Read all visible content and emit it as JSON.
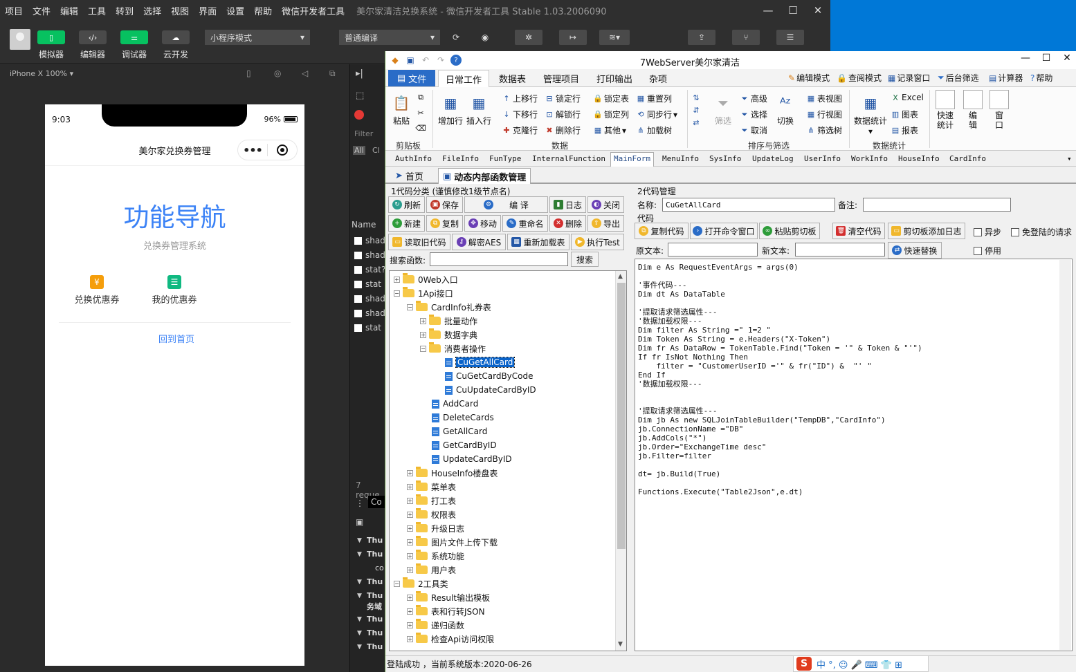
{
  "devtools": {
    "menu": [
      "项目",
      "文件",
      "编辑",
      "工具",
      "转到",
      "选择",
      "视图",
      "界面",
      "设置",
      "帮助",
      "微信开发者工具"
    ],
    "window_title": "美尔家清洁兑换系统 - 微信开发者工具 Stable 1.03.2006090",
    "window_controls": {
      "minimize": "—",
      "maximize": "☐",
      "close": "✕"
    },
    "toolbar": {
      "simulator": "模拟器",
      "editor": "编辑器",
      "debugger": "调试器",
      "cloud": "云开发",
      "mode_select": "小程序模式",
      "compile_select": "普通编译"
    },
    "device_label": "iPhone X 100% ▾",
    "simulator": {
      "time": "9:03",
      "battery": "96%",
      "nav_title": "美尔家兑换券管理",
      "capsule_dots": "•••",
      "heading": "功能导航",
      "subtitle": "兑换券管理系统",
      "function_items": [
        {
          "label": "兑换优惠券",
          "icon": "¥",
          "color": "#f59e0b"
        },
        {
          "label": "我的优惠券",
          "icon": "☰",
          "color": "#10b981"
        }
      ],
      "back_link": "回到首页"
    },
    "panel": {
      "filter_placeholder": "Filter",
      "all": "All",
      "clear": "Cl",
      "name_header": "Name",
      "requests": [
        "shado",
        "shado",
        "stat?",
        "stat",
        "shado",
        "shado",
        "stat"
      ],
      "request_count": "7 reque",
      "console_tab": "Co",
      "log_rows": [
        "Thu",
        "Thu",
        "co",
        "Thu",
        "Thu",
        "务域",
        "Thu",
        "Thu",
        "Thu"
      ]
    }
  },
  "app": {
    "title": "7WebServer美尔家清洁",
    "window_controls": {
      "minimize": "—",
      "maximize": "☐",
      "close": "✕"
    },
    "ribbon_tabs": [
      "文件",
      "日常工作",
      "数据表",
      "管理项目",
      "打印输出",
      "杂项"
    ],
    "ribbon_right": [
      "编辑模式",
      "查阅模式",
      "记录窗口",
      "后台筛选",
      "计算器",
      "帮助"
    ],
    "ribbon": {
      "clipboard": {
        "group": "剪贴板",
        "paste": "粘贴"
      },
      "data": {
        "group": "数据",
        "add_row": "增加行",
        "insert_row": "插入行",
        "move_up": "上移行",
        "move_down": "下移行",
        "clone_row": "克隆行",
        "lock_row": "锁定行",
        "unlock_row": "解锁行",
        "delete_row": "删除行",
        "lock_table": "锁定表",
        "lock_col": "锁定列",
        "other": "其他",
        "reset_col": "重置列",
        "sync_row": "同步行",
        "load_tree": "加载树"
      },
      "sort_filter": {
        "group": "排序与筛选",
        "filter": "筛选",
        "advanced": "高级",
        "select": "选择",
        "cancel": "取消",
        "switch": "切换",
        "table_view": "表视图",
        "row_view": "行视图",
        "filter_tree": "筛选树"
      },
      "stats": {
        "group": "数据统计",
        "data_stats": "数据统计",
        "excel": "Excel",
        "chart": "图表",
        "report": "报表",
        "quick_stats_1": "快速",
        "quick_stats_2": "统计",
        "edit_1": "编",
        "edit_2": "辑",
        "window_1": "窗",
        "window_2": "口"
      }
    },
    "form_tabs": [
      "AuthInfo",
      "FileInfo",
      "FunType",
      "InternalFunction",
      "MainForm",
      "MenuInfo",
      "SysInfo",
      "UpdateLog",
      "UserInfo",
      "WorkInfo",
      "HouseInfo",
      "CardInfo"
    ],
    "doc_tabs": {
      "home": "首页",
      "active": "动态内部函数管理"
    },
    "left": {
      "title": "1代码分类 (谨慎修改1级节点名)",
      "buttons": {
        "refresh": "刷新",
        "save": "保存",
        "compile": "编 译",
        "log": "日志",
        "close": "关闭",
        "new": "新建",
        "copy": "复制",
        "move": "移动",
        "rename": "重命名",
        "delete": "删除",
        "export": "导出",
        "read_old": "读取旧代码",
        "decrypt": "解密AES",
        "reload": "重新加载表",
        "exec": "执行Test"
      },
      "search_label": "搜索函数:",
      "search_value": "",
      "search_button": "搜索"
    },
    "tree": [
      {
        "text": "0Web入口",
        "level": 0,
        "type": "folder",
        "expander": "+"
      },
      {
        "text": "1Api接口",
        "level": 0,
        "type": "folder",
        "expander": "−"
      },
      {
        "text": "CardInfo礼券表",
        "level": 1,
        "type": "folder",
        "expander": "−"
      },
      {
        "text": "批量动作",
        "level": 2,
        "type": "folder",
        "expander": "+"
      },
      {
        "text": "数据字典",
        "level": 2,
        "type": "folder",
        "expander": "+"
      },
      {
        "text": "消费者操作",
        "level": 2,
        "type": "folder",
        "expander": "−"
      },
      {
        "text": "CuGetAllCard",
        "level": 3,
        "type": "doc",
        "selected": true
      },
      {
        "text": "CuGetCardByCode",
        "level": 3,
        "type": "doc"
      },
      {
        "text": "CuUpdateCardByID",
        "level": 3,
        "type": "doc"
      },
      {
        "text": "AddCard",
        "level": 2,
        "type": "doc"
      },
      {
        "text": "DeleteCards",
        "level": 2,
        "type": "doc"
      },
      {
        "text": "GetAllCard",
        "level": 2,
        "type": "doc"
      },
      {
        "text": "GetCardByID",
        "level": 2,
        "type": "doc"
      },
      {
        "text": "UpdateCardByID",
        "level": 2,
        "type": "doc"
      },
      {
        "text": "HouseInfo楼盘表",
        "level": 1,
        "type": "folder",
        "expander": "+"
      },
      {
        "text": "菜单表",
        "level": 1,
        "type": "folder",
        "expander": "+"
      },
      {
        "text": "打工表",
        "level": 1,
        "type": "folder",
        "expander": "+"
      },
      {
        "text": "权限表",
        "level": 1,
        "type": "folder",
        "expander": "+"
      },
      {
        "text": "升级日志",
        "level": 1,
        "type": "folder",
        "expander": "+"
      },
      {
        "text": "图片文件上传下载",
        "level": 1,
        "type": "folder",
        "expander": "+"
      },
      {
        "text": "系统功能",
        "level": 1,
        "type": "folder",
        "expander": "+"
      },
      {
        "text": "用户表",
        "level": 1,
        "type": "folder",
        "expander": "+"
      },
      {
        "text": "2工具类",
        "level": 0,
        "type": "folder",
        "expander": "−"
      },
      {
        "text": "Result输出模板",
        "level": 1,
        "type": "folder",
        "expander": "+"
      },
      {
        "text": "表和行转JSON",
        "level": 1,
        "type": "folder",
        "expander": "+"
      },
      {
        "text": "递归函数",
        "level": 1,
        "type": "folder",
        "expander": "+"
      },
      {
        "text": "检查Api访问权限",
        "level": 1,
        "type": "folder",
        "expander": "+"
      }
    ],
    "right": {
      "title": "2代码管理",
      "name_label": "名称:",
      "name_value": "CuGetAllCard",
      "remark_label": "备注:",
      "remark_value": "",
      "code_label": "代码",
      "buttons": {
        "copy_code": "复制代码",
        "open_cmd": "打开命令窗口",
        "paste_clip": "粘贴剪切板",
        "clear_code": "清空代码",
        "clip_log": "剪切板添加日志",
        "quick_replace": "快速替换"
      },
      "async": "异步",
      "no_login": "免登陆的请求",
      "disable": "停用",
      "orig_label": "原文本:",
      "new_label": "新文本:",
      "code": "Dim e As RequestEventArgs = args(0)\n\n'事件代码---\nDim dt As DataTable\n\n'提取请求筛选属性---\n'数据加载权限---\nDim filter As String =\" 1=2 \"\nDim Token As String = e.Headers(\"X-Token\")\nDim fr As DataRow = TokenTable.Find(\"Token = '\" & Token & \"'\")\nIf fr IsNot Nothing Then\n    filter = \"CustomerUserID ='\" & fr(\"ID\") &  \"' \"\nEnd If\n'数据加载权限---\n\n\n'提取请求筛选属性---\nDim jb As new SQLJoinTableBuilder(\"TempDB\",\"CardInfo\")\njb.ConnectionName =\"DB\"\njb.AddCols(\"*\")\njb.Order=\"ExchangeTime desc\"\njb.Filter=filter\n\ndt= jb.Build(True)\n\nFunctions.Execute(\"Table2Json\",e.dt)"
    },
    "status": "登陆成功  ，当前系统版本:2020-06-26",
    "ime": "中 °, ☺ 🎤 ⌨ 👕 ⊞"
  }
}
